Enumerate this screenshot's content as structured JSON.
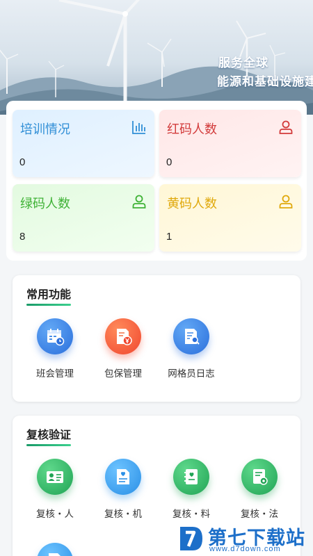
{
  "banner": {
    "slogan_line1": "服务全球",
    "slogan_line2": "能源和基础设施建"
  },
  "stats": [
    {
      "title": "培训情况",
      "value": "0",
      "icon": "bar-chart-icon",
      "color": "#2f8ed6"
    },
    {
      "title": "红码人数",
      "value": "0",
      "icon": "person-icon",
      "color": "#d23b3b"
    },
    {
      "title": "绿码人数",
      "value": "8",
      "icon": "person-icon",
      "color": "#3fb236"
    },
    {
      "title": "黄码人数",
      "value": "1",
      "icon": "person-icon",
      "color": "#e0a90c"
    }
  ],
  "common_functions": {
    "title": "常用功能",
    "items": [
      {
        "label": "班会管理",
        "icon": "calendar-clock-icon"
      },
      {
        "label": "包保管理",
        "icon": "document-yen-icon"
      },
      {
        "label": "网格员日志",
        "icon": "document-search-icon"
      }
    ]
  },
  "review": {
    "title": "复核验证",
    "items": [
      {
        "label": "复核・人",
        "icon": "id-card-icon"
      },
      {
        "label": "复核・机",
        "icon": "document-heart-icon"
      },
      {
        "label": "复核・料",
        "icon": "notebook-heart-icon"
      },
      {
        "label": "复核・法",
        "icon": "certificate-gear-icon"
      }
    ]
  },
  "watermark": {
    "name": "第七下载站",
    "url": "www.d7down.com"
  },
  "colors": {
    "accent_green": "#1a9a68",
    "watermark_blue": "#1d6fc9"
  }
}
